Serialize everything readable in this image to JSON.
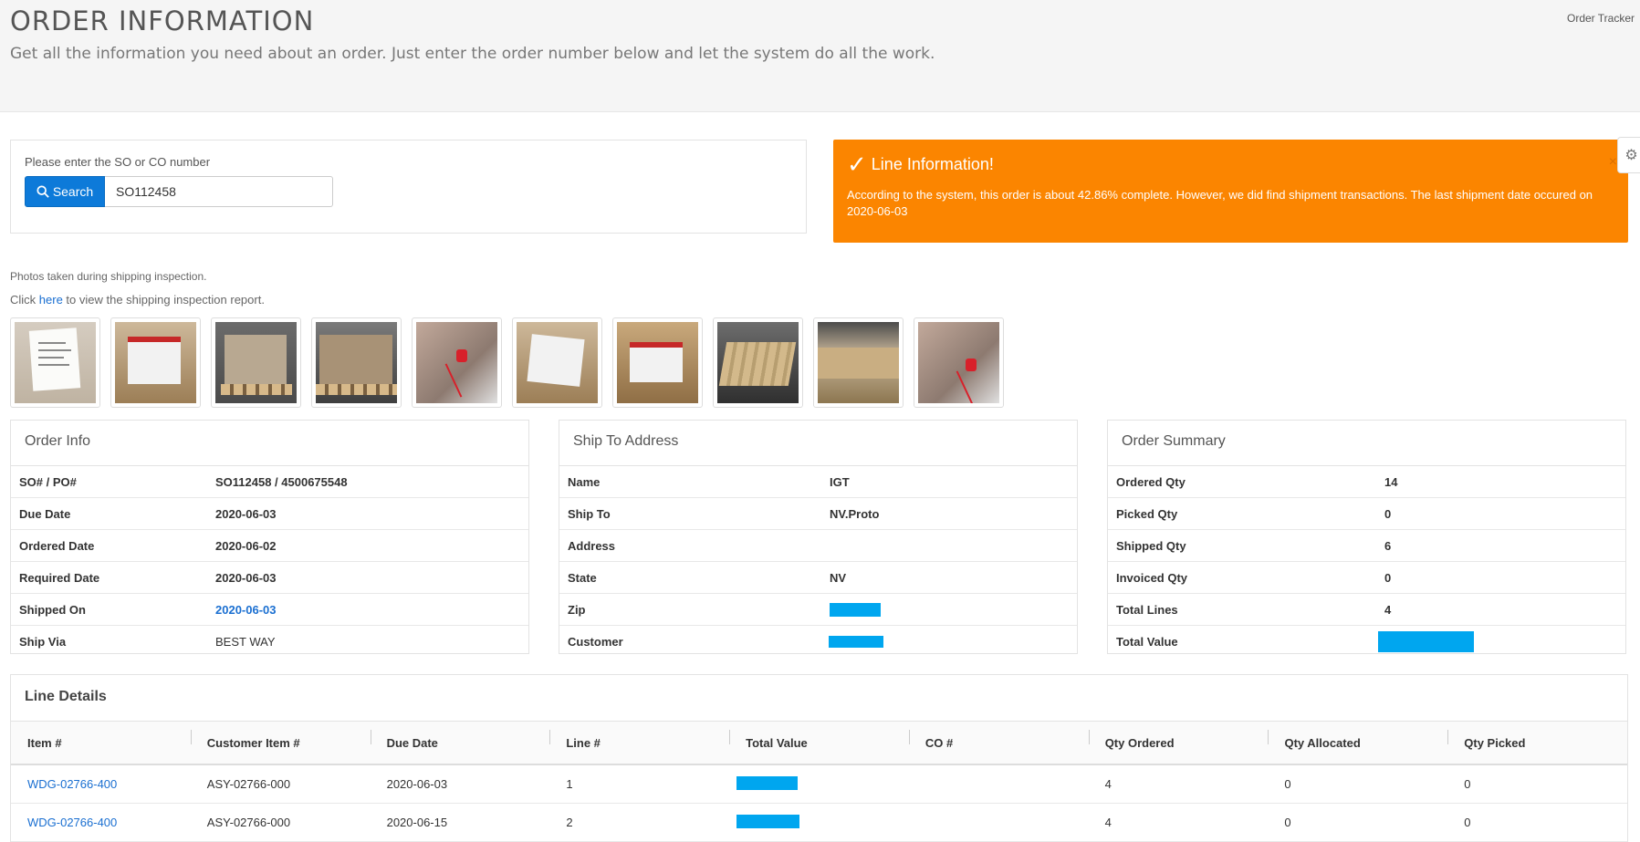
{
  "header": {
    "title": "ORDER INFORMATION",
    "subtitle": "Get all the information you need about an order. Just enter the order number below and let the system do all the work.",
    "breadcrumb": "Order Tracker"
  },
  "search": {
    "label": "Please enter the SO or CO number",
    "button_label": "Search",
    "value": "SO112458"
  },
  "alert": {
    "title": "Line Information!",
    "message": "According to the system, this order is about 42.86% complete. However, we did find shipment transactions. The last shipment date occured on 2020-06-03",
    "close": "×",
    "color": "#fb8500"
  },
  "photos": {
    "note": "Photos taken during shipping inspection.",
    "click_prefix": "Click ",
    "click_link": "here",
    "click_suffix": " to view the shipping inspection report."
  },
  "order_info": {
    "title": "Order Info",
    "rows": [
      {
        "label": "SO# / PO#",
        "value": "SO112458 / 4500675548"
      },
      {
        "label": "Due Date",
        "value": "2020-06-03"
      },
      {
        "label": "Ordered Date",
        "value": "2020-06-02"
      },
      {
        "label": "Required Date",
        "value": "2020-06-03"
      },
      {
        "label": "Shipped On",
        "value": "2020-06-03"
      },
      {
        "label": "Ship Via",
        "value": "BEST WAY"
      }
    ]
  },
  "ship_to": {
    "title": "Ship To Address",
    "rows": [
      {
        "label": "Name",
        "value": "IGT"
      },
      {
        "label": "Ship To",
        "value": "NV.Proto"
      },
      {
        "label": "Address",
        "value": ""
      },
      {
        "label": "State",
        "value": "NV"
      },
      {
        "label": "Zip",
        "value": ""
      },
      {
        "label": "Customer",
        "value": ""
      }
    ]
  },
  "order_summary": {
    "title": "Order Summary",
    "rows": [
      {
        "label": "Ordered Qty",
        "value": "14"
      },
      {
        "label": "Picked Qty",
        "value": "0"
      },
      {
        "label": "Shipped Qty",
        "value": "6"
      },
      {
        "label": "Invoiced Qty",
        "value": "0"
      },
      {
        "label": "Total Lines",
        "value": "4"
      },
      {
        "label": "Total Value",
        "value": ""
      }
    ]
  },
  "line_details": {
    "title": "Line Details",
    "columns": [
      "Item #",
      "Customer Item #",
      "Due Date",
      "Line #",
      "Total Value",
      "CO #",
      "Qty Ordered",
      "Qty Allocated",
      "Qty Picked"
    ],
    "rows": [
      {
        "item": "WDG-02766-400",
        "customer_item": "ASY-02766-000",
        "due_date": "2020-06-03",
        "line": "1",
        "total_value": "",
        "co": "",
        "qty_ordered": "4",
        "qty_allocated": "0",
        "qty_picked": "0"
      },
      {
        "item": "WDG-02766-400",
        "customer_item": "ASY-02766-000",
        "due_date": "2020-06-15",
        "line": "2",
        "total_value": "",
        "co": "",
        "qty_ordered": "4",
        "qty_allocated": "0",
        "qty_picked": "0"
      }
    ]
  },
  "colors": {
    "primary": "#0d7ad9",
    "redaction": "#00a6ef",
    "link": "#1a6fd1"
  }
}
